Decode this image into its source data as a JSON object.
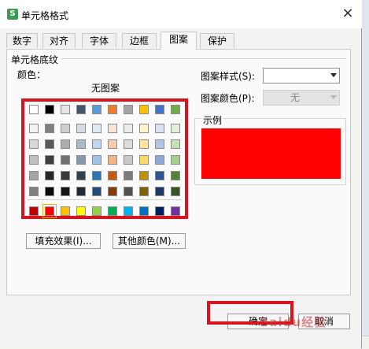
{
  "window": {
    "title": "单元格格式",
    "app_icon_letter": "S"
  },
  "tabs": [
    {
      "label": "数字",
      "active": false
    },
    {
      "label": "对齐",
      "active": false
    },
    {
      "label": "字体",
      "active": false
    },
    {
      "label": "边框",
      "active": false
    },
    {
      "label": "图案",
      "active": true
    },
    {
      "label": "保护",
      "active": false
    }
  ],
  "shading": {
    "group_label": "单元格底纹",
    "color_label": "颜色：",
    "no_pattern": "无图案",
    "selected_color": "#ff0000",
    "palette_rows": [
      [
        "#ffffff",
        "#000000",
        "#e7e6e6",
        "#44546a",
        "#5b9bd5",
        "#ed7d31",
        "#a5a5a5",
        "#ffc000",
        "#4472c4",
        "#70ad47"
      ],
      [
        "#f2f2f2",
        "#7f7f7f",
        "#d0cece",
        "#d6dce4",
        "#deebf6",
        "#fbe5d5",
        "#ededed",
        "#fff2cc",
        "#dae3f3",
        "#e2efd9"
      ],
      [
        "#d8d8d8",
        "#595959",
        "#aeabab",
        "#adb9ca",
        "#bdd7ee",
        "#f7cbac",
        "#dbdbdb",
        "#fee599",
        "#b4c6e7",
        "#c5e0b3"
      ],
      [
        "#bfbfbf",
        "#3f3f3f",
        "#757070",
        "#8496b0",
        "#9dc3e6",
        "#f4b183",
        "#c9c9c9",
        "#ffd965",
        "#8eaadb",
        "#a8d08d"
      ],
      [
        "#a5a5a5",
        "#262626",
        "#3a3838",
        "#323f4f",
        "#2e75b5",
        "#c55a11",
        "#7b7b7b",
        "#bf9000",
        "#2f5496",
        "#538135"
      ],
      [
        "#7f7f7f",
        "#0c0c0c",
        "#171616",
        "#222a35",
        "#1e4e79",
        "#833c0b",
        "#525252",
        "#7f6000",
        "#1f3864",
        "#375623"
      ]
    ],
    "standard_row": [
      "#c00000",
      "#ff0000",
      "#ffc000",
      "#ffff00",
      "#92d050",
      "#00b050",
      "#00b0f0",
      "#0070c0",
      "#002060",
      "#7030a0"
    ],
    "fill_effects_button": "填充效果(I)...",
    "more_colors_button": "其他颜色(M)..."
  },
  "pattern": {
    "style_label": "图案样式(S):",
    "style_value": "",
    "color_label": "图案颜色(P):",
    "color_value": "无"
  },
  "preview": {
    "label": "示例"
  },
  "footer": {
    "ok_button": "确定",
    "cancel_button": "取消"
  },
  "watermark": "Baidu经验",
  "colors": {
    "highlight_frame": "#d7151e",
    "dialog_bg": "#f3f3f3"
  }
}
